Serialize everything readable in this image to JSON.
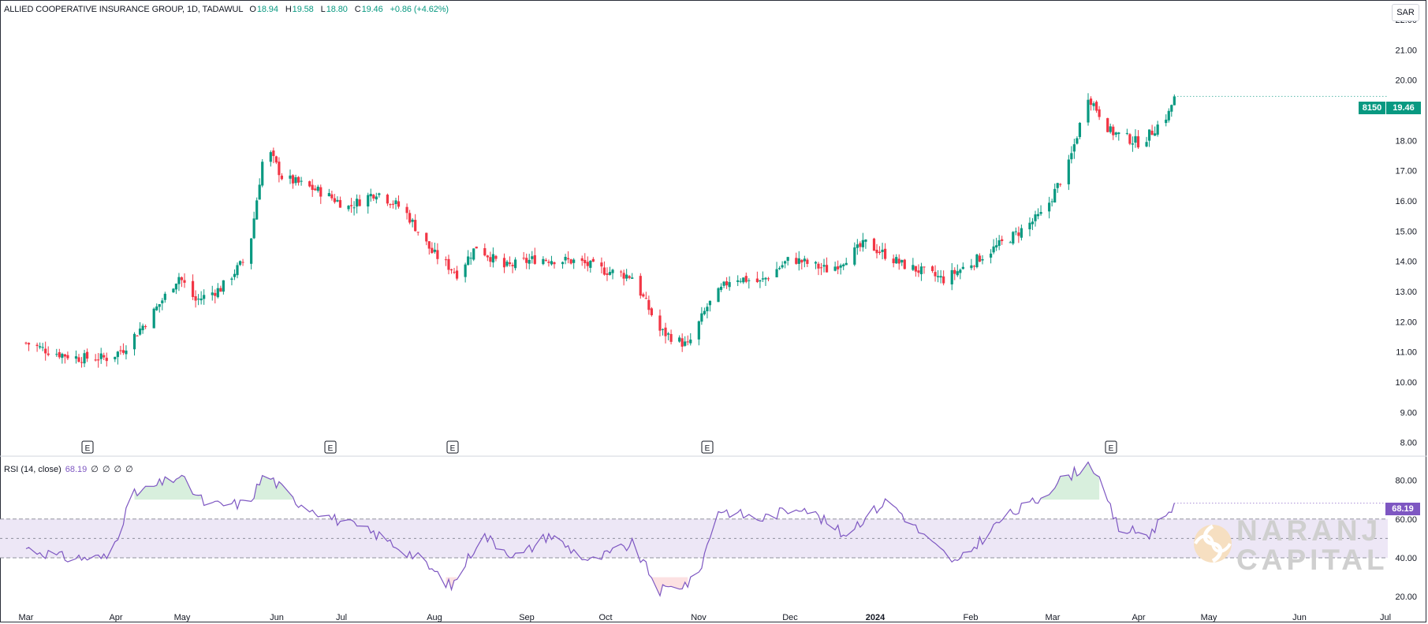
{
  "legend": {
    "symbol": "ALLIED COOPERATIVE INSURANCE GROUP, 1D, TADAWUL",
    "o_label": "O",
    "o_value": "18.94",
    "h_label": "H",
    "h_value": "19.58",
    "l_label": "L",
    "l_value": "18.80",
    "c_label": "C",
    "c_value": "19.46",
    "change": "+0.86 (+4.62%)"
  },
  "currency": "SAR",
  "price_tag": {
    "symbol": "8150",
    "price": "19.46"
  },
  "rsi": {
    "label": "RSI (14, close)",
    "value": "68.19",
    "extra": [
      "∅",
      "∅",
      "∅",
      "∅"
    ]
  },
  "watermark": {
    "line1": "NARANJ",
    "line2": "CAPITAL"
  },
  "colors": {
    "up": "#089981",
    "down": "#f23645",
    "rsi": "#7e57c2",
    "band": "#ede7f6",
    "earnings_icon": "#131722"
  },
  "chart_data": {
    "type": "candlestick",
    "title": "ALLIED COOPERATIVE INSURANCE GROUP, 1D, TADAWUL",
    "price_axis": {
      "ticks": [
        "22.00",
        "21.00",
        "20.00",
        "19.00",
        "18.00",
        "17.00",
        "16.00",
        "15.00",
        "14.00",
        "13.00",
        "12.00",
        "11.00",
        "10.00",
        "9.00",
        "8.00"
      ],
      "range": [
        7.6,
        22.6
      ]
    },
    "time_axis": {
      "ticks": [
        "Mar",
        "Apr",
        "May",
        "Jun",
        "Jul",
        "Aug",
        "Sep",
        "Oct",
        "Nov",
        "Dec",
        "2024",
        "Feb",
        "Mar",
        "Apr",
        "May",
        "Jun",
        "Jul"
      ]
    },
    "earnings_markers": [
      "E",
      "E",
      "E",
      "E",
      "E"
    ],
    "rsi_axis": {
      "ticks": [
        "80.00",
        "60.00",
        "40.00",
        "20.00"
      ],
      "range": [
        14,
        92
      ],
      "band": [
        40,
        60
      ],
      "mid": 50
    },
    "close_series": [
      {
        "x": "2023-03-01",
        "close": 11.3
      },
      {
        "x": "2023-03-10",
        "close": 11.0
      },
      {
        "x": "2023-03-20",
        "close": 10.8
      },
      {
        "x": "2023-03-31",
        "close": 10.8
      },
      {
        "x": "2023-04-05",
        "close": 11.1
      },
      {
        "x": "2023-04-15",
        "close": 12.2
      },
      {
        "x": "2023-04-25",
        "close": 13.5
      },
      {
        "x": "2023-05-01",
        "close": 12.7
      },
      {
        "x": "2023-05-10",
        "close": 13.1
      },
      {
        "x": "2023-05-20",
        "close": 14.2
      },
      {
        "x": "2023-05-26",
        "close": 17.9
      },
      {
        "x": "2023-06-01",
        "close": 16.8
      },
      {
        "x": "2023-06-15",
        "close": 16.3
      },
      {
        "x": "2023-06-25",
        "close": 15.8
      },
      {
        "x": "2023-07-05",
        "close": 16.3
      },
      {
        "x": "2023-07-15",
        "close": 15.7
      },
      {
        "x": "2023-07-25",
        "close": 14.3
      },
      {
        "x": "2023-08-03",
        "close": 13.6
      },
      {
        "x": "2023-08-10",
        "close": 14.5
      },
      {
        "x": "2023-08-20",
        "close": 13.8
      },
      {
        "x": "2023-09-01",
        "close": 14.1
      },
      {
        "x": "2023-09-15",
        "close": 14.0
      },
      {
        "x": "2023-09-25",
        "close": 13.7
      },
      {
        "x": "2023-10-05",
        "close": 13.5
      },
      {
        "x": "2023-10-15",
        "close": 11.7
      },
      {
        "x": "2023-10-25",
        "close": 11.2
      },
      {
        "x": "2023-11-01",
        "close": 12.5
      },
      {
        "x": "2023-11-10",
        "close": 13.5
      },
      {
        "x": "2023-11-20",
        "close": 13.3
      },
      {
        "x": "2023-12-01",
        "close": 14.1
      },
      {
        "x": "2023-12-15",
        "close": 13.7
      },
      {
        "x": "2023-12-28",
        "close": 14.6
      },
      {
        "x": "2024-01-10",
        "close": 13.9
      },
      {
        "x": "2024-01-25",
        "close": 13.4
      },
      {
        "x": "2024-02-05",
        "close": 14.0
      },
      {
        "x": "2024-02-20",
        "close": 14.9
      },
      {
        "x": "2024-03-01",
        "close": 15.6
      },
      {
        "x": "2024-03-10",
        "close": 17.2
      },
      {
        "x": "2024-03-17",
        "close": 19.5
      },
      {
        "x": "2024-03-25",
        "close": 18.3
      },
      {
        "x": "2024-04-05",
        "close": 17.9
      },
      {
        "x": "2024-04-15",
        "close": 18.9
      },
      {
        "x": "2024-04-17",
        "close": 19.46
      }
    ],
    "rsi_series": [
      {
        "x": "2023-03-01",
        "rsi": 45
      },
      {
        "x": "2023-03-15",
        "rsi": 40
      },
      {
        "x": "2023-03-31",
        "rsi": 40
      },
      {
        "x": "2023-04-08",
        "rsi": 72
      },
      {
        "x": "2023-04-25",
        "rsi": 82
      },
      {
        "x": "2023-05-05",
        "rsi": 67
      },
      {
        "x": "2023-05-20",
        "rsi": 68
      },
      {
        "x": "2023-05-26",
        "rsi": 84
      },
      {
        "x": "2023-06-05",
        "rsi": 70
      },
      {
        "x": "2023-06-20",
        "rsi": 60
      },
      {
        "x": "2023-07-05",
        "rsi": 52
      },
      {
        "x": "2023-07-20",
        "rsi": 40
      },
      {
        "x": "2023-08-01",
        "rsi": 25
      },
      {
        "x": "2023-08-12",
        "rsi": 52
      },
      {
        "x": "2023-08-25",
        "rsi": 40
      },
      {
        "x": "2023-09-05",
        "rsi": 52
      },
      {
        "x": "2023-09-20",
        "rsi": 38
      },
      {
        "x": "2023-10-05",
        "rsi": 47
      },
      {
        "x": "2023-10-15",
        "rsi": 23
      },
      {
        "x": "2023-10-28",
        "rsi": 28
      },
      {
        "x": "2023-11-05",
        "rsi": 65
      },
      {
        "x": "2023-11-20",
        "rsi": 60
      },
      {
        "x": "2023-12-05",
        "rsi": 67
      },
      {
        "x": "2023-12-20",
        "rsi": 52
      },
      {
        "x": "2024-01-05",
        "rsi": 70
      },
      {
        "x": "2024-01-20",
        "rsi": 48
      },
      {
        "x": "2024-01-30",
        "rsi": 37
      },
      {
        "x": "2024-02-15",
        "rsi": 60
      },
      {
        "x": "2024-02-28",
        "rsi": 70
      },
      {
        "x": "2024-03-05",
        "rsi": 78
      },
      {
        "x": "2024-03-18",
        "rsi": 89
      },
      {
        "x": "2024-03-28",
        "rsi": 55
      },
      {
        "x": "2024-04-08",
        "rsi": 52
      },
      {
        "x": "2024-04-17",
        "rsi": 68.19
      }
    ]
  }
}
